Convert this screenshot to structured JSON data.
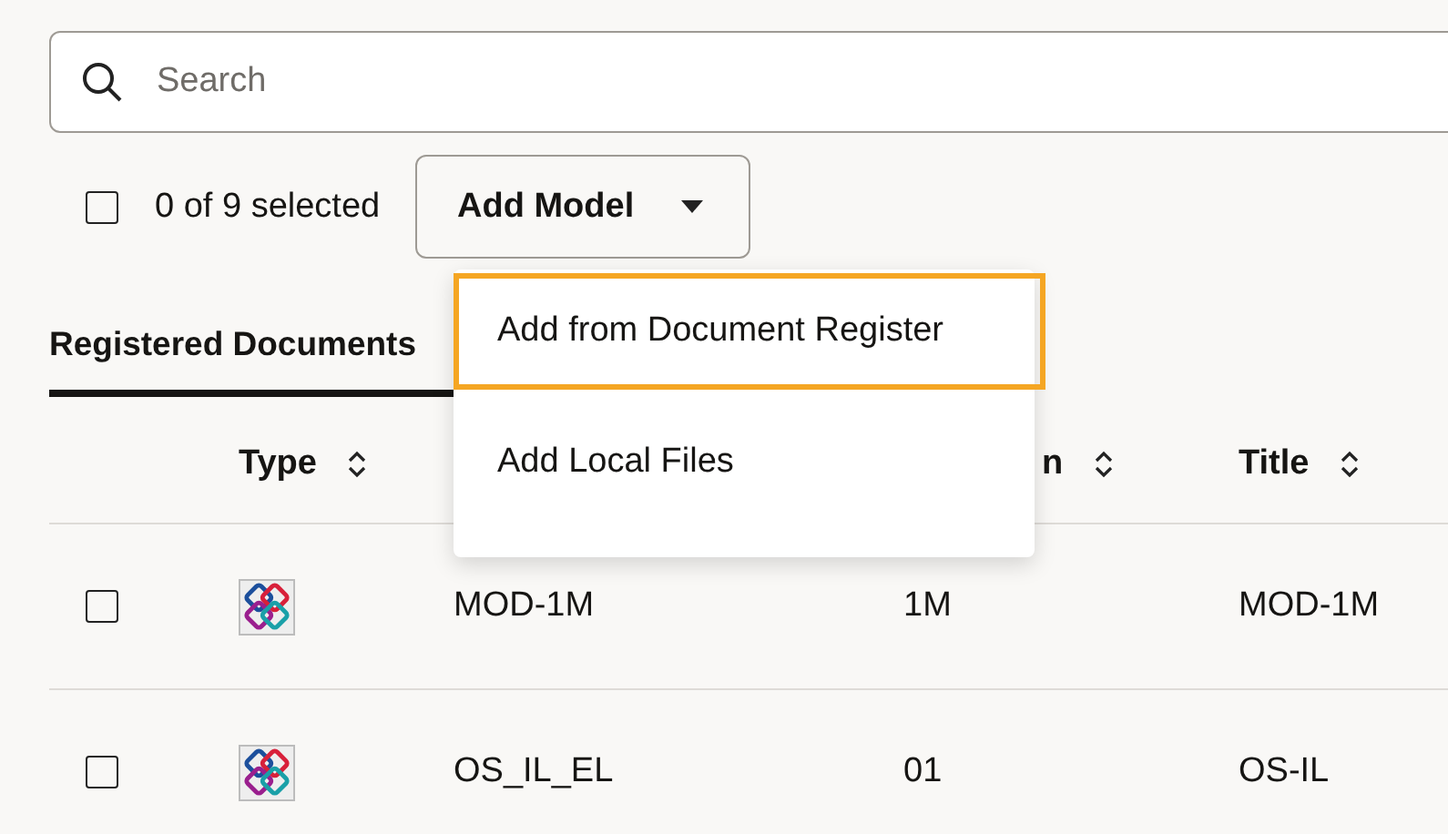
{
  "search": {
    "placeholder": "Search"
  },
  "selection": {
    "checked": false,
    "label": "0 of 9 selected"
  },
  "add_model_button": {
    "label": "Add Model",
    "expanded": true
  },
  "menu": [
    {
      "label": "Add from Document Register",
      "selected": true
    },
    {
      "label": "Add Local Files",
      "selected": false
    }
  ],
  "tabs": [
    {
      "label": "Registered Documents",
      "selected": true
    }
  ],
  "table": {
    "columns": [
      {
        "label": "Type"
      },
      {
        "label": "n"
      },
      {
        "label": "Title"
      }
    ],
    "rows": [
      {
        "checked": false,
        "cells": [
          "MOD-1M",
          "1M",
          "MOD-1M"
        ]
      },
      {
        "checked": false,
        "cells": [
          "OS_IL_EL",
          "01",
          "OS-IL"
        ]
      }
    ]
  }
}
